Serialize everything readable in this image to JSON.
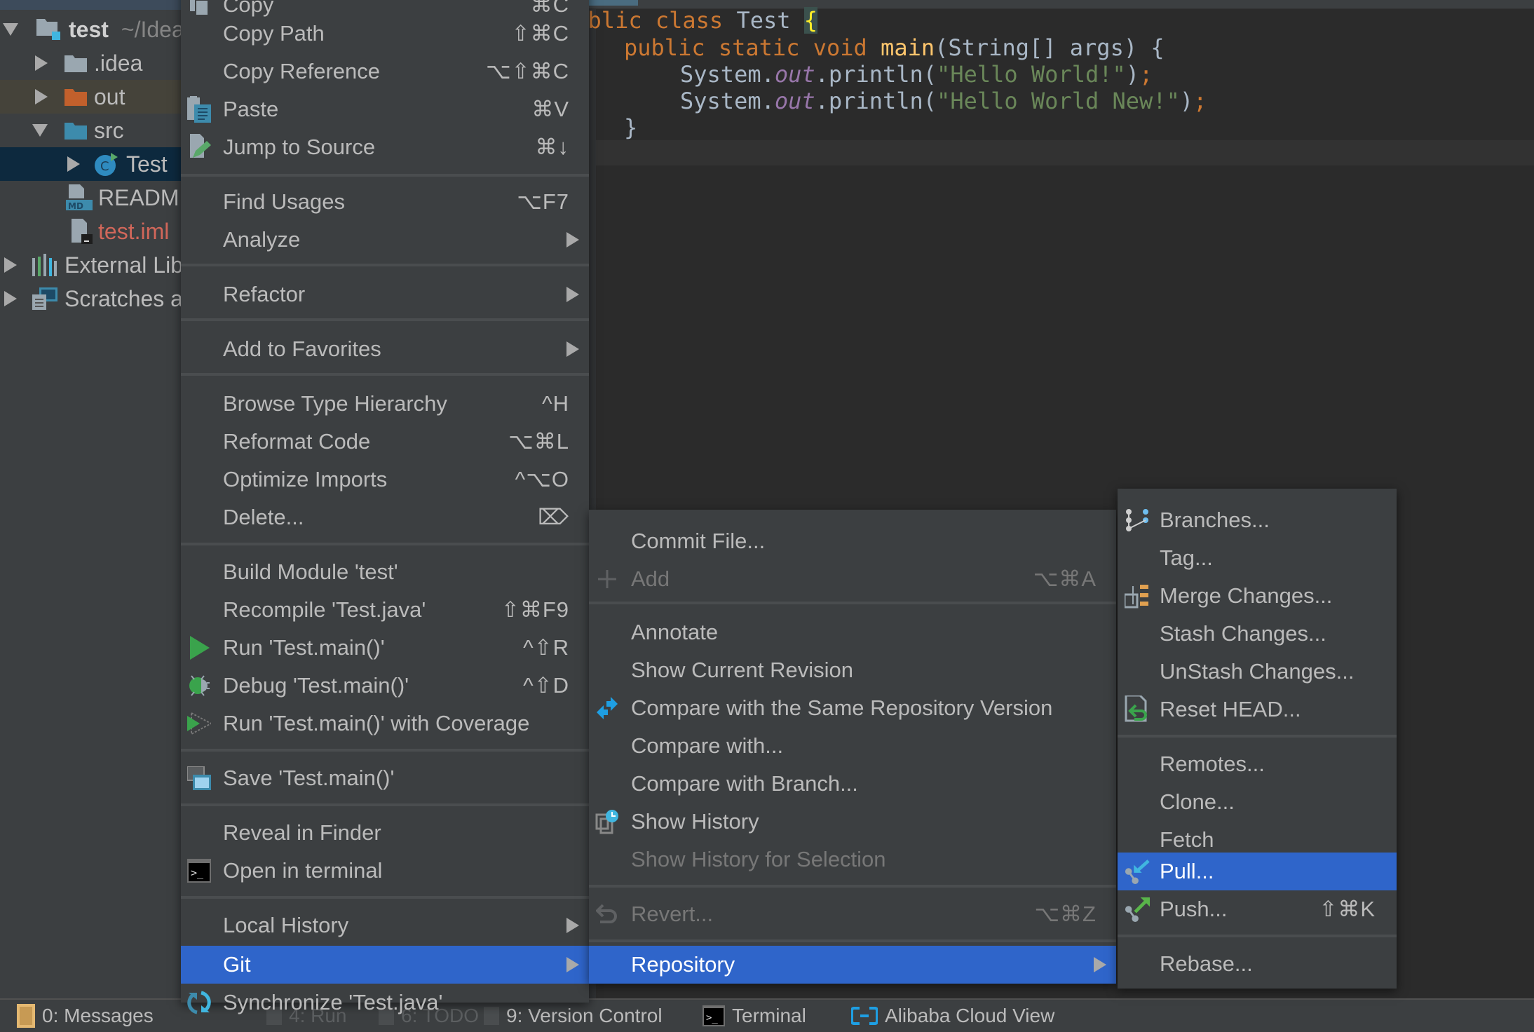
{
  "project_tree": {
    "root": {
      "name": "test",
      "path": "~/IdeaProjects/test"
    },
    "items": [
      {
        "label": ".idea",
        "type": "folder",
        "expanded": false
      },
      {
        "label": "out",
        "type": "folder-excluded",
        "expanded": false
      },
      {
        "label": "src",
        "type": "source-folder",
        "expanded": true
      },
      {
        "label": "Test",
        "type": "java-class",
        "selected": true
      },
      {
        "label": "README.md",
        "type": "markdown-file"
      },
      {
        "label": "test.iml",
        "type": "module-file",
        "status": "unversioned"
      },
      {
        "label": "External Libraries",
        "type": "libraries"
      },
      {
        "label": "Scratches and Consoles",
        "type": "scratches"
      }
    ]
  },
  "editor": {
    "lines": [
      [
        "public ",
        "class ",
        "Test ",
        "{"
      ],
      [
        "public static void ",
        "main",
        "(String[] args) {"
      ],
      [
        "System.",
        "out",
        ".println(",
        "\"Hello World!\"",
        ")",
        ";"
      ],
      [
        "System.",
        "out",
        ".println(",
        "\"Hello World New!\"",
        ")",
        ";"
      ],
      [
        "}"
      ]
    ]
  },
  "context_menu": {
    "items": [
      {
        "label": "Copy",
        "shortcut": "⌘C",
        "icon": "copy-icon"
      },
      {
        "label": "Copy Path",
        "shortcut": "⇧⌘C"
      },
      {
        "label": "Copy Reference",
        "shortcut": "⌥⇧⌘C"
      },
      {
        "label": "Paste",
        "shortcut": "⌘V",
        "icon": "paste-icon"
      },
      {
        "label": "Jump to Source",
        "shortcut": "⌘↓",
        "icon": "jump-to-source-icon"
      },
      {
        "label": "Find Usages",
        "shortcut": "⌥F7"
      },
      {
        "label": "Analyze",
        "submenu": true
      },
      {
        "label": "Refactor",
        "submenu": true
      },
      {
        "label": "Add to Favorites",
        "submenu": true
      },
      {
        "label": "Browse Type Hierarchy",
        "shortcut": "^H"
      },
      {
        "label": "Reformat Code",
        "shortcut": "⌥⌘L"
      },
      {
        "label": "Optimize Imports",
        "shortcut": "^⌥O"
      },
      {
        "label": "Delete...",
        "shortcut": "⌦"
      },
      {
        "label": "Build Module 'test'"
      },
      {
        "label": "Recompile 'Test.java'",
        "shortcut": "⇧⌘F9"
      },
      {
        "label": "Run 'Test.main()'",
        "shortcut": "^⇧R",
        "icon": "run-icon"
      },
      {
        "label": "Debug 'Test.main()'",
        "shortcut": "^⇧D",
        "icon": "debug-icon"
      },
      {
        "label": "Run 'Test.main()' with Coverage",
        "icon": "coverage-icon"
      },
      {
        "label": "Save 'Test.main()'",
        "icon": "save-config-icon"
      },
      {
        "label": "Reveal in Finder"
      },
      {
        "label": "Open in terminal",
        "icon": "terminal-icon"
      },
      {
        "label": "Local History",
        "submenu": true
      },
      {
        "label": "Git",
        "submenu": true,
        "active": true
      },
      {
        "label": "Synchronize 'Test.java'",
        "icon": "sync-icon"
      }
    ]
  },
  "git_menu": {
    "items": [
      {
        "label": "Commit File..."
      },
      {
        "label": "Add",
        "shortcut": "⌥⌘A",
        "icon": "plus-icon",
        "disabled": true
      },
      {
        "label": "Annotate"
      },
      {
        "label": "Show Current Revision"
      },
      {
        "label": "Compare with the Same Repository Version",
        "icon": "compare-icon"
      },
      {
        "label": "Compare with..."
      },
      {
        "label": "Compare with Branch..."
      },
      {
        "label": "Show History",
        "icon": "history-icon"
      },
      {
        "label": "Show History for Selection",
        "disabled": true
      },
      {
        "label": "Revert...",
        "shortcut": "⌥⌘Z",
        "icon": "revert-icon",
        "disabled": true
      },
      {
        "label": "Repository",
        "submenu": true,
        "active": true
      }
    ]
  },
  "repository_menu": {
    "items": [
      {
        "label": "Branches...",
        "icon": "branches-icon"
      },
      {
        "label": "Tag..."
      },
      {
        "label": "Merge Changes...",
        "icon": "merge-icon"
      },
      {
        "label": "Stash Changes..."
      },
      {
        "label": "UnStash Changes..."
      },
      {
        "label": "Reset HEAD...",
        "icon": "reset-head-icon"
      },
      {
        "label": "Remotes..."
      },
      {
        "label": "Clone..."
      },
      {
        "label": "Fetch"
      },
      {
        "label": "Pull...",
        "icon": "pull-icon",
        "active": true
      },
      {
        "label": "Push...",
        "shortcut": "⇧⌘K",
        "icon": "push-icon"
      },
      {
        "label": "Rebase..."
      }
    ]
  },
  "status_bar": {
    "items": [
      {
        "label": "0: Messages",
        "icon": "messages-icon"
      },
      {
        "label": "4: Run",
        "icon": "run-tool-icon"
      },
      {
        "label": "6: TODO",
        "icon": "todo-icon"
      },
      {
        "label": "9: Version Control",
        "icon": "version-control-icon"
      },
      {
        "label": "Terminal",
        "icon": "terminal-tool-icon"
      },
      {
        "label": "Alibaba Cloud View",
        "icon": "alibaba-cloud-icon"
      }
    ]
  },
  "colors": {
    "menu_bg": "#3c3f41",
    "selection": "#2f65ca",
    "editor_bg": "#2b2b2b",
    "keyword": "#cc7832",
    "string": "#6a8759",
    "unversioned_file": "#d1675a"
  }
}
